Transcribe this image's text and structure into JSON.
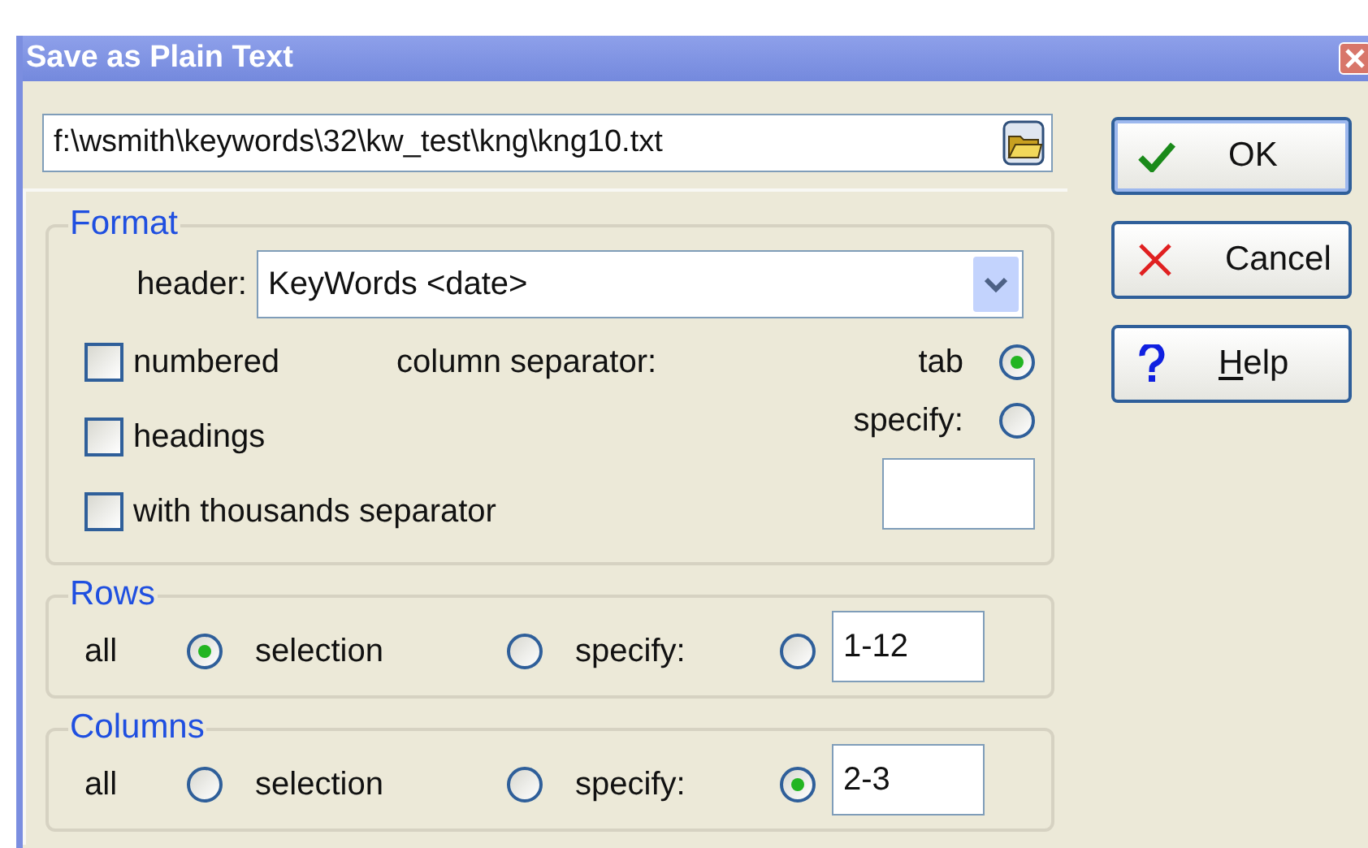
{
  "window": {
    "title": "Save as Plain Text"
  },
  "file_path": {
    "value": "f:\\wsmith\\keywords\\32\\kw_test\\kng\\kng10.txt"
  },
  "format": {
    "title": "Format",
    "header_label": "header:",
    "header_value": "KeyWords <date>",
    "checkboxes": [
      {
        "label": "numbered",
        "checked": false
      },
      {
        "label": "headings",
        "checked": false
      },
      {
        "label": "with thousands separator",
        "checked": false
      }
    ],
    "separator_label": "column separator:",
    "separator_options": [
      {
        "label": "tab",
        "selected": true
      },
      {
        "label": "specify:",
        "selected": false
      }
    ]
  },
  "groups": [
    {
      "title": "Rows",
      "options": [
        {
          "label": "all",
          "selected": true
        },
        {
          "label": "selection",
          "selected": false
        },
        {
          "label": "specify:",
          "selected": false
        }
      ],
      "value": "1-12"
    },
    {
      "title": "Columns",
      "options": [
        {
          "label": "all",
          "selected": false
        },
        {
          "label": "selection",
          "selected": false
        },
        {
          "label": "specify:",
          "selected": true
        }
      ],
      "value": "2-3"
    }
  ],
  "buttons": [
    {
      "kind": "ok",
      "label": "OK",
      "mnemonic_underlined": false
    },
    {
      "kind": "cancel",
      "label": "Cancel",
      "mnemonic_underlined": false
    },
    {
      "kind": "help",
      "label": "Help",
      "mnemonic_underlined": true
    }
  ]
}
